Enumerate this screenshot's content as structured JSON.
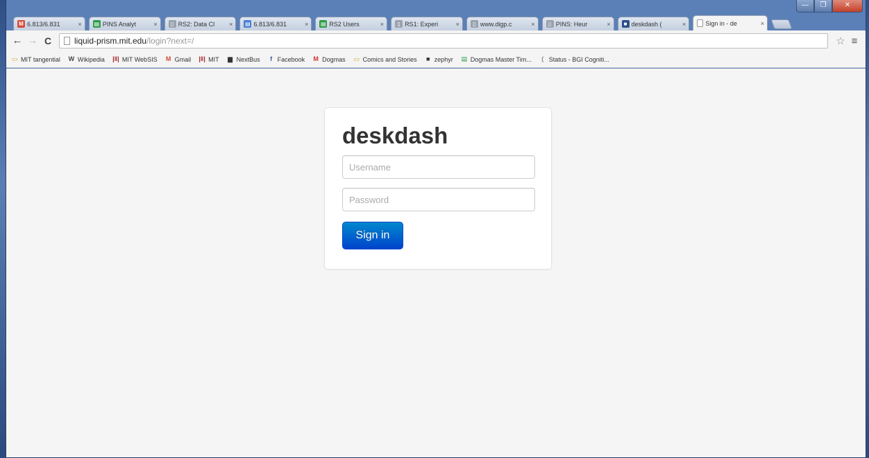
{
  "window": {
    "controls": {
      "minimize": "—",
      "maximize": "❐",
      "close": "✕"
    }
  },
  "tabs": [
    {
      "label": "6.813/6.831",
      "icon_color": "#d84a3a",
      "icon_glyph": "M",
      "active": false
    },
    {
      "label": "PINS Analyt",
      "icon_color": "#2e9b4a",
      "icon_glyph": "▤",
      "active": false
    },
    {
      "label": "RS2: Data Cl",
      "icon_color": "#9aa3ad",
      "icon_glyph": "▯",
      "active": false
    },
    {
      "label": "6.813/6.831",
      "icon_color": "#4a7fd0",
      "icon_glyph": "▤",
      "active": false
    },
    {
      "label": "RS2 Users",
      "icon_color": "#2e9b4a",
      "icon_glyph": "▤",
      "active": false
    },
    {
      "label": "RS1: Experi",
      "icon_color": "#9aa3ad",
      "icon_glyph": "▯",
      "active": false
    },
    {
      "label": "www.digp.c",
      "icon_color": "#9aa3ad",
      "icon_glyph": "▯",
      "active": false
    },
    {
      "label": "PINS: Heur",
      "icon_color": "#9aa3ad",
      "icon_glyph": "▯",
      "active": false
    },
    {
      "label": "deskdash (",
      "icon_color": "#2b4f8a",
      "icon_glyph": "■",
      "active": false
    },
    {
      "label": "Sign in - de",
      "icon_color": "#ffffff",
      "icon_glyph": "",
      "active": true
    }
  ],
  "toolbar": {
    "back": "←",
    "forward": "→",
    "reload": "C",
    "url_host": "liquid-prism.mit.edu",
    "url_path": "/login?next=/",
    "star": "☆",
    "menu": "≡"
  },
  "bookmarks": [
    {
      "label": "MIT tangential",
      "icon": "▭",
      "icon_color": "#d9a72a"
    },
    {
      "label": "Wikipedia",
      "icon": "W",
      "icon_color": "#444444"
    },
    {
      "label": "MIT WebSIS",
      "icon": "|‖|",
      "icon_color": "#a3232a"
    },
    {
      "label": "Gmail",
      "icon": "M",
      "icon_color": "#d84a3a"
    },
    {
      "label": "MIT",
      "icon": "|‖|",
      "icon_color": "#a3232a"
    },
    {
      "label": "NextBus",
      "icon": "▆",
      "icon_color": "#333333"
    },
    {
      "label": "Facebook",
      "icon": "f",
      "icon_color": "#3b5998"
    },
    {
      "label": "Dogmas",
      "icon": "M",
      "icon_color": "#d63031"
    },
    {
      "label": "Comics and Stories",
      "icon": "▭",
      "icon_color": "#d9a72a"
    },
    {
      "label": "zephyr",
      "icon": "■",
      "icon_color": "#333333"
    },
    {
      "label": "Dogmas Master Tim...",
      "icon": "▤",
      "icon_color": "#2e9b4a"
    },
    {
      "label": "Status - BGI Cogniti...",
      "icon": "(",
      "icon_color": "#888888"
    }
  ],
  "login": {
    "brand": "deskdash",
    "username_placeholder": "Username",
    "username_value": "",
    "password_placeholder": "Password",
    "password_value": "",
    "submit_label": "Sign in"
  },
  "colors": {
    "accent": "#0055cc",
    "page_background": "#f5f5f5"
  }
}
